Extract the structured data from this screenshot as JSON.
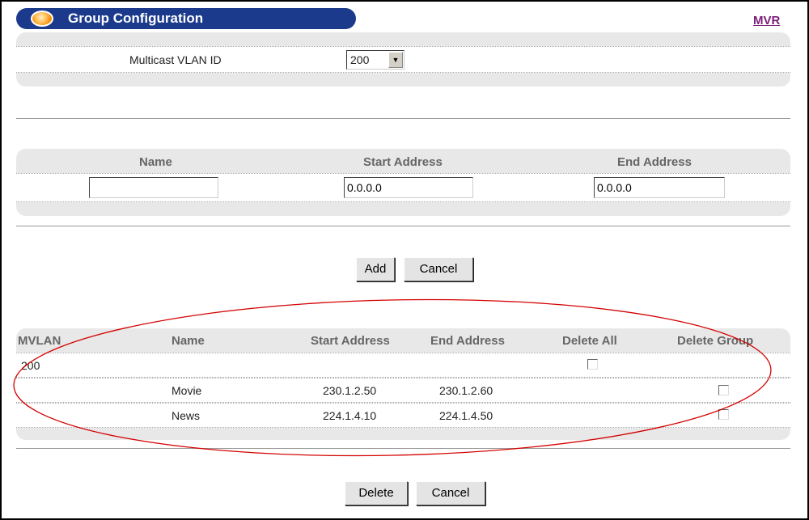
{
  "header": {
    "title": "Group Configuration",
    "link": "MVR"
  },
  "vlan": {
    "label": "Multicast VLAN ID",
    "selected": "200"
  },
  "form": {
    "headers": {
      "name": "Name",
      "start": "Start Address",
      "end": "End Address"
    },
    "name_value": "",
    "start_value": "0.0.0.0",
    "end_value": "0.0.0.0",
    "add_label": "Add",
    "cancel_label": "Cancel"
  },
  "table": {
    "headers": {
      "mvlan": "MVLAN",
      "name": "Name",
      "start": "Start Address",
      "end": "End Address",
      "delete_all": "Delete All",
      "delete_group": "Delete Group"
    },
    "vlan_row": {
      "mvlan": "200"
    },
    "groups": [
      {
        "name": "Movie",
        "start": "230.1.2.50",
        "end": "230.1.2.60"
      },
      {
        "name": "News",
        "start": "224.1.4.10",
        "end": "224.1.4.50"
      }
    ],
    "delete_label": "Delete",
    "cancel_label": "Cancel"
  },
  "colors": {
    "title_bar": "#1b3a8c",
    "link": "#7a1e78",
    "highlight_ellipse": "#d40000"
  }
}
